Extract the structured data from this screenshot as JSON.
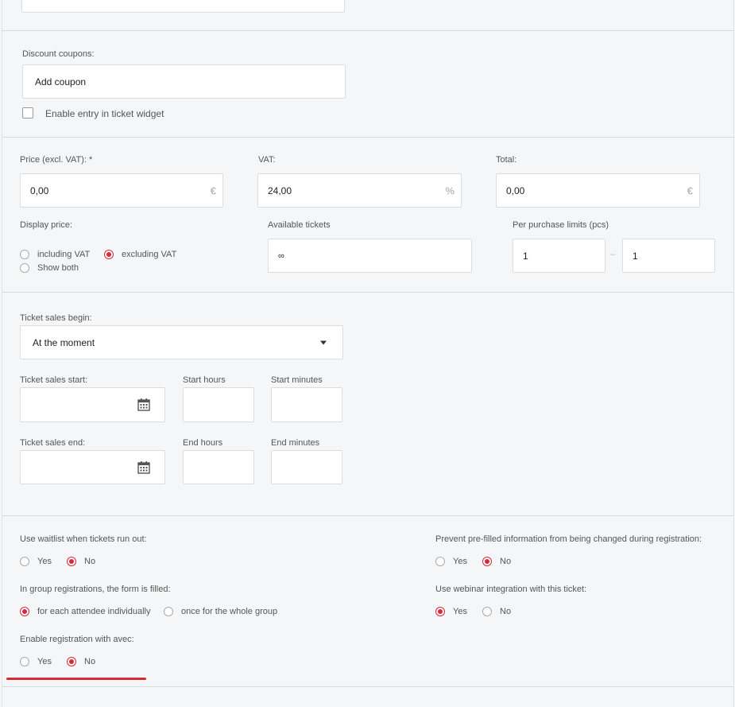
{
  "coupons": {
    "label": "Discount coupons:",
    "button": "Add coupon",
    "checkbox_label": "Enable entry in ticket widget"
  },
  "pricing": {
    "price_label": "Price (excl. VAT): *",
    "price_value": "0,00",
    "price_unit": "€",
    "vat_label": "VAT:",
    "vat_value": "24,00",
    "vat_unit": "%",
    "total_label": "Total:",
    "total_value": "0,00",
    "total_unit": "€",
    "display_label": "Display price:",
    "display_options": [
      "including VAT",
      "excluding VAT",
      "Show both"
    ],
    "display_selected": "excluding VAT",
    "available_label": "Available tickets",
    "available_value": "∞",
    "limits_label": "Per purchase limits (pcs)",
    "limit_min": "1",
    "limit_dash": "–",
    "limit_max": "1"
  },
  "sales": {
    "begin_label": "Ticket sales begin:",
    "begin_value": "At the moment",
    "start_label": "Ticket sales start:",
    "start_hours_label": "Start hours",
    "start_minutes_label": "Start minutes",
    "end_label": "Ticket sales end:",
    "end_hours_label": "End hours",
    "end_minutes_label": "End minutes"
  },
  "options": {
    "waitlist_label": "Use waitlist when tickets run out:",
    "group_label": "In group registrations, the form is filled:",
    "group_options": [
      "for each attendee individually",
      "once for the whole group"
    ],
    "avec_label": "Enable registration with avec:",
    "prefill_label": "Prevent pre-filled information from being changed during registration:",
    "webinar_label": "Use webinar integration with this ticket:",
    "yes": "Yes",
    "no": "No",
    "waitlist_selected": "No",
    "group_selected": "for each attendee individually",
    "avec_selected": "No",
    "prefill_selected": "No",
    "webinar_selected": "Yes"
  },
  "colors": {
    "accent": "#d9283c",
    "border": "#dcdcdc",
    "background": "#f5f6f7"
  },
  "icons": {
    "calendar": "calendar-icon",
    "dropdown": "chevron-down-icon"
  }
}
